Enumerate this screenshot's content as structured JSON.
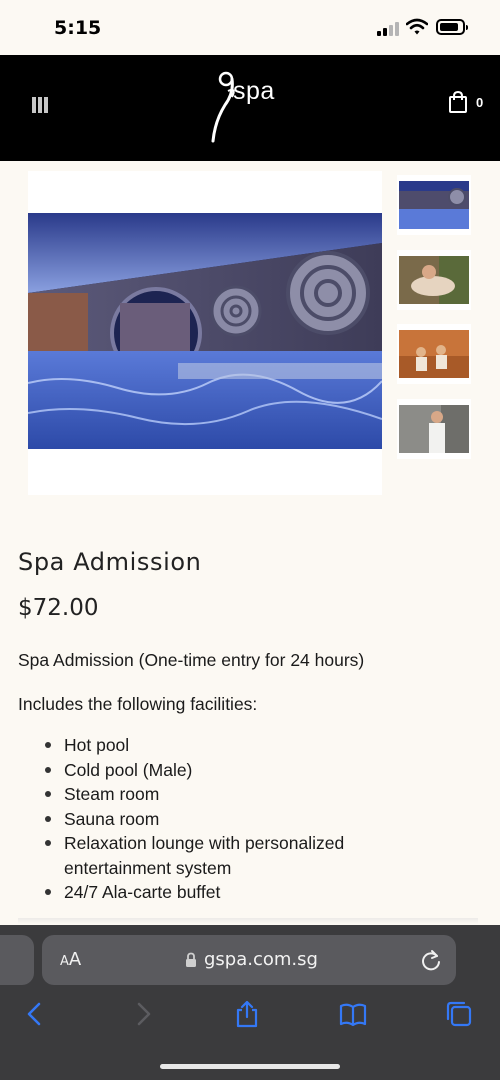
{
  "status_bar": {
    "time": "5:15",
    "signal_icon": "cellular-signal-icon",
    "wifi_icon": "wifi-icon",
    "battery_icon": "battery-icon"
  },
  "header": {
    "menu_icon": "hamburger-menu-icon",
    "logo_text": "spa",
    "cart_icon": "shopping-bag-icon",
    "cart_count": "0",
    "background": "#000000"
  },
  "gallery": {
    "main_image": "spa-pool-photo",
    "thumbnails": [
      "spa-pool-thumbnail",
      "woman-relaxing-thumbnail",
      "sauna-room-thumbnail",
      "woman-in-towel-thumbnail"
    ]
  },
  "product": {
    "title": "Spa Admission",
    "price": "$72.00",
    "description": "Spa Admission (One-time entry for 24 hours)",
    "facilities_heading": "Includes the following facilities:",
    "facilities": [
      "Hot pool",
      "Cold pool (Male)",
      "Steam room",
      "Sauna room",
      "Relaxation lounge with personalized entertainment system",
      "24/7 Ala-carte buffet"
    ]
  },
  "browser": {
    "aa_label_small": "A",
    "aa_label_large": "A",
    "url": "gspa.com.sg",
    "lock_icon": "lock-icon",
    "reload_icon": "reload-icon",
    "toolbar": [
      "back-icon",
      "forward-icon",
      "share-icon",
      "bookmarks-icon",
      "tabs-icon"
    ],
    "accent_color": "#3478f6"
  }
}
